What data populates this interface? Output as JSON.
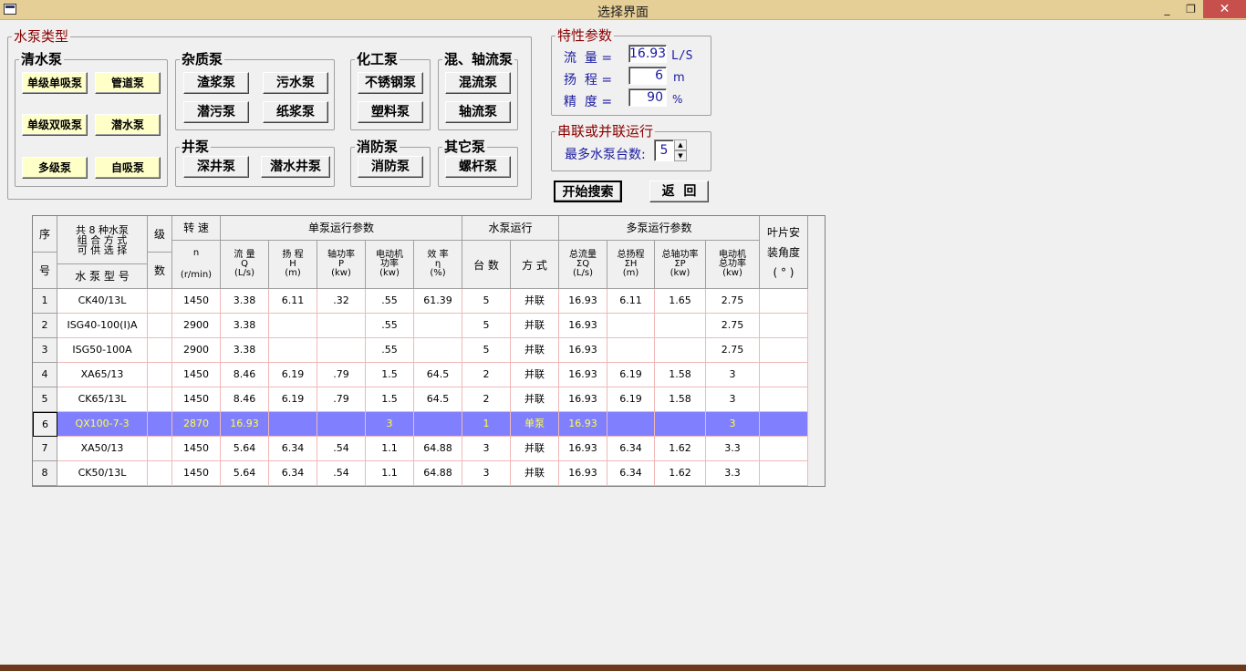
{
  "window": {
    "title": "选择界面",
    "minimize": "_",
    "maximize": "❐",
    "close": "✕"
  },
  "pump_type": {
    "legend": "水泵类型",
    "clear_water": {
      "legend": "清水泵",
      "buttons": [
        "单级单吸泵",
        "管道泵",
        "单级双吸泵",
        "潜水泵",
        "多级泵",
        "自吸泵"
      ]
    },
    "impurity": {
      "legend": "杂质泵",
      "buttons": [
        "渣浆泵",
        "污水泵",
        "潜污泵",
        "纸浆泵"
      ]
    },
    "chemical": {
      "legend": "化工泵",
      "buttons": [
        "不锈钢泵",
        "塑料泵"
      ]
    },
    "mixed_axial": {
      "legend": "混、轴流泵",
      "buttons": [
        "混流泵",
        "轴流泵"
      ]
    },
    "well": {
      "legend": "井泵",
      "buttons": [
        "深井泵",
        "潜水井泵"
      ]
    },
    "fire": {
      "legend": "消防泵",
      "buttons": [
        "消防泵"
      ]
    },
    "other": {
      "legend": "其它泵",
      "buttons": [
        "螺杆泵"
      ]
    }
  },
  "characteristics": {
    "legend": "特性参数",
    "flow": {
      "label": "流  量 =",
      "value": "16.93",
      "unit": "L/S"
    },
    "head": {
      "label": "扬  程 =",
      "value": "6",
      "unit": "m"
    },
    "precision": {
      "label": "精  度 =",
      "value": "90",
      "unit": "%"
    }
  },
  "series": {
    "legend": "串联或并联运行",
    "label": "最多水泵台数:",
    "value": "5"
  },
  "actions": {
    "search": "开始搜索",
    "back": "返  回"
  },
  "table": {
    "h_seq_top": "序",
    "h_seq_bottom": "号",
    "h_model_top": "共 8 种水泵\n组 合 方 式\n可 供 选 择",
    "h_model_bottom": "水 泵 型 号",
    "h_stage_top": "级",
    "h_stage_bottom": "数",
    "h_speed_top": "转  速",
    "h_speed_mid": "n",
    "h_speed_bottom": "(r/min)",
    "g_single": "单泵运行参数",
    "g_run": "水泵运行",
    "g_multi": "多泵运行参数",
    "h_blade": "叶片安\n装角度\n( ° )",
    "sub": [
      "流  量\nQ\n(L/s)",
      "扬  程\nH\n(m)",
      "轴功率\nP\n(kw)",
      "电动机\n功率\n(kw)",
      "效  率\nη\n(%)",
      "台  数",
      "方  式",
      "总流量\nΣQ\n(L/s)",
      "总扬程\nΣH\n(m)",
      "总轴功率\nΣP\n(kw)",
      "电动机\n总功率\n(kw)"
    ],
    "rows": [
      [
        "1",
        "CK40/13L",
        "",
        "1450",
        "3.38",
        "6.11",
        ".32",
        ".55",
        "61.39",
        "5",
        "并联",
        "16.93",
        "6.11",
        "1.65",
        "2.75",
        ""
      ],
      [
        "2",
        "ISG40-100(I)A",
        "",
        "2900",
        "3.38",
        "",
        "",
        ".55",
        "",
        "5",
        "并联",
        "16.93",
        "",
        "",
        "2.75",
        ""
      ],
      [
        "3",
        "ISG50-100A",
        "",
        "2900",
        "3.38",
        "",
        "",
        ".55",
        "",
        "5",
        "并联",
        "16.93",
        "",
        "",
        "2.75",
        ""
      ],
      [
        "4",
        "XA65/13",
        "",
        "1450",
        "8.46",
        "6.19",
        ".79",
        "1.5",
        "64.5",
        "2",
        "并联",
        "16.93",
        "6.19",
        "1.58",
        "3",
        ""
      ],
      [
        "5",
        "CK65/13L",
        "",
        "1450",
        "8.46",
        "6.19",
        ".79",
        "1.5",
        "64.5",
        "2",
        "并联",
        "16.93",
        "6.19",
        "1.58",
        "3",
        ""
      ],
      [
        "6",
        "QX100-7-3",
        "",
        "2870",
        "16.93",
        "",
        "",
        "3",
        "",
        "1",
        "单泵",
        "16.93",
        "",
        "",
        "3",
        ""
      ],
      [
        "7",
        "XA50/13",
        "",
        "1450",
        "5.64",
        "6.34",
        ".54",
        "1.1",
        "64.88",
        "3",
        "并联",
        "16.93",
        "6.34",
        "1.62",
        "3.3",
        ""
      ],
      [
        "8",
        "CK50/13L",
        "",
        "1450",
        "5.64",
        "6.34",
        ".54",
        "1.1",
        "64.88",
        "3",
        "并联",
        "16.93",
        "6.34",
        "1.62",
        "3.3",
        ""
      ]
    ],
    "selected_row": 6
  }
}
